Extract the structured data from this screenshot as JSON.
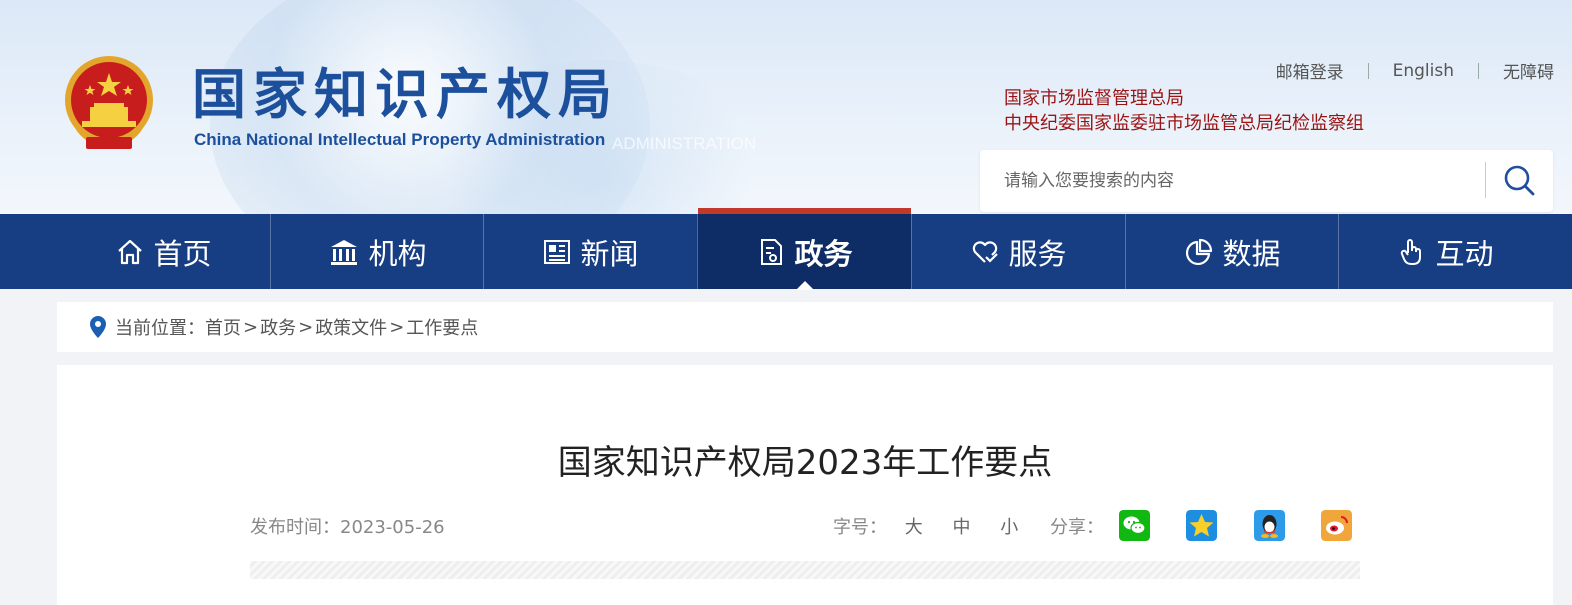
{
  "header": {
    "title": "国家知识产权局",
    "subtitle": "China National Intellectual Property Administration",
    "watermark_text": "ADMINISTRATION",
    "top_links": [
      "邮箱登录",
      "English",
      "无障碍"
    ],
    "supervisors": [
      "国家市场监督管理总局",
      "中央纪委国家监委驻市场监管总局纪检监察组"
    ],
    "search_placeholder": "请输入您要搜索的内容"
  },
  "nav": {
    "items": [
      {
        "label": "首页",
        "icon": "home-icon"
      },
      {
        "label": "机构",
        "icon": "building-icon"
      },
      {
        "label": "新闻",
        "icon": "newspaper-icon"
      },
      {
        "label": "政务",
        "icon": "document-icon"
      },
      {
        "label": "服务",
        "icon": "heart-hand-icon"
      },
      {
        "label": "数据",
        "icon": "pie-chart-icon"
      },
      {
        "label": "互动",
        "icon": "pointer-hand-icon"
      }
    ],
    "active_label": "政务"
  },
  "breadcrumb": {
    "prefix": "当前位置：",
    "items": [
      "首页",
      "政务",
      "政策文件",
      "工作要点"
    ],
    "separator": ">"
  },
  "article": {
    "title": "国家知识产权局2023年工作要点",
    "date_label": "发布时间：",
    "date": "2023-05-26",
    "font_size_label": "字号：",
    "font_sizes": [
      "大",
      "中",
      "小"
    ],
    "share_label": "分享：",
    "share_targets": [
      "wechat-icon",
      "qzone-icon",
      "qq-icon",
      "weibo-icon"
    ]
  },
  "colors": {
    "nav_bg": "#173d83",
    "nav_active_bg": "#0e2c66",
    "nav_active_accent": "#c0392b",
    "title_blue": "#1c4f9c",
    "supervisor_red": "#9b1414"
  }
}
